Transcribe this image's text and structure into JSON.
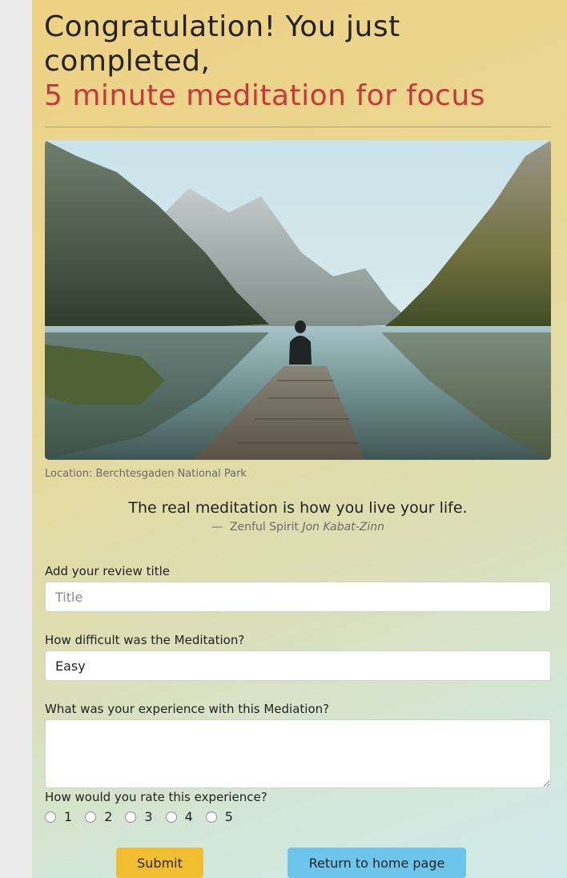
{
  "header": {
    "title_line1": "Congratulation! You just",
    "title_line2": "completed,",
    "meditation_name": "5 minute meditation for focus"
  },
  "photo": {
    "caption": "Location: Berchtesgaden National Park"
  },
  "quote": {
    "text": "The real meditation is how you live your life.",
    "dash": "—",
    "source": "Zenful Spirit",
    "author": "Jon Kabat-Zinn"
  },
  "form": {
    "review_title": {
      "label": "Add your review title",
      "placeholder": "Title",
      "value": ""
    },
    "difficulty": {
      "label": "How difficult was the Meditation?",
      "value": "Easy"
    },
    "experience": {
      "label": "What was your experience with this Mediation?",
      "value": ""
    },
    "rating": {
      "label": "How would you rate this experience?",
      "options": [
        "1",
        "2",
        "3",
        "4",
        "5"
      ]
    },
    "submit_label": "Submit",
    "home_label": "Return to home page"
  },
  "colors": {
    "accent": "#c8373a",
    "submit": "#f1be31",
    "home": "#6cc6ec"
  }
}
